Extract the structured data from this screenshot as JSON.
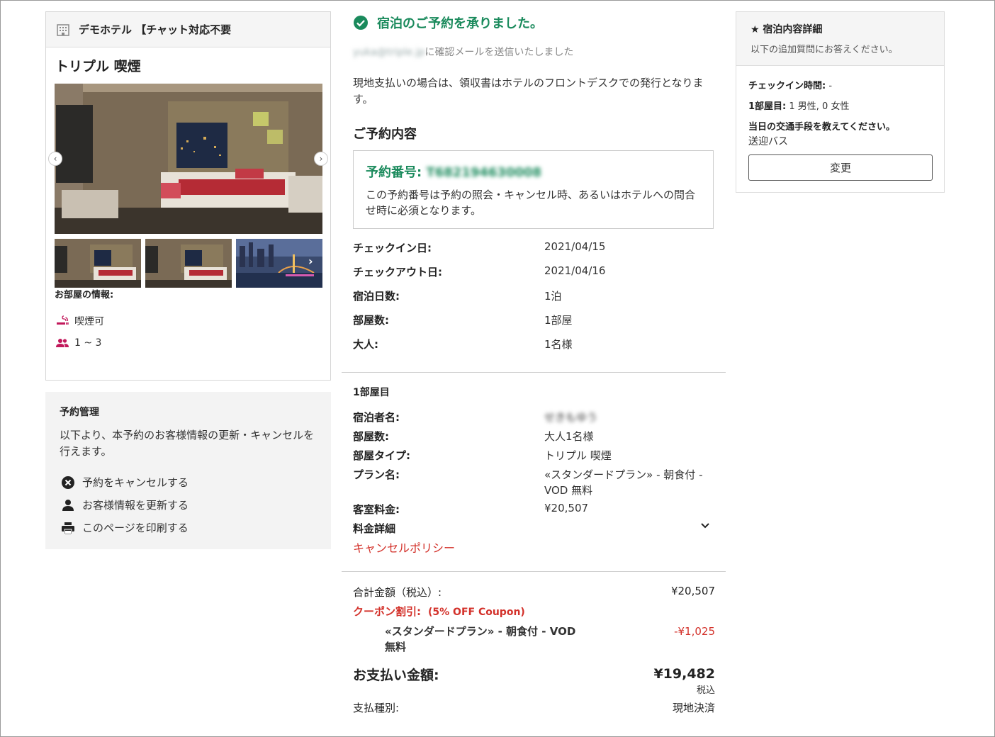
{
  "hotel": {
    "name": "デモホテル 【チャット対応不要",
    "room_title": "トリプル 喫煙",
    "room_info_label": "お部屋の情報:",
    "features": [
      {
        "icon": "smoking-icon",
        "label": "喫煙可"
      },
      {
        "icon": "people-icon",
        "label": "1 ~ 3"
      }
    ]
  },
  "manage": {
    "title": "予約管理",
    "description": "以下より、本予約のお客様情報の更新・キャンセルを行えます。",
    "links": [
      {
        "icon": "cancel-icon",
        "label": "予約をキャンセルする"
      },
      {
        "icon": "person-icon",
        "label": "お客様情報を更新する"
      },
      {
        "icon": "print-icon",
        "label": "このページを印刷する"
      }
    ]
  },
  "confirmation": {
    "success_message": "宿泊のご予約を承りました。",
    "email_blurred": "yuka@triple.jp",
    "email_suffix": "に確認メールを送信いたしました",
    "receipt_note": "現地支払いの場合は、領収書はホテルのフロントデスクでの発行となります。",
    "reservation_heading": "ご予約内容",
    "reservation_number_label": "予約番号:",
    "reservation_number_blurred": "T682194630008",
    "reservation_number_note": "この予約番号は予約の照会・キャンセル時、あるいはホテルへの問合せ時に必須となります。"
  },
  "stay": {
    "checkin_label": "チェックイン日:",
    "checkin": "2021/04/15",
    "checkout_label": "チェックアウト日:",
    "checkout": "2021/04/16",
    "nights_label": "宿泊日数:",
    "nights": "1泊",
    "rooms_label": "部屋数:",
    "rooms": "1部屋",
    "adults_label": "大人:",
    "adults": "1名様"
  },
  "room1": {
    "heading": "1部屋目",
    "guest_label": "宿泊者名:",
    "guest_blurred": "せきもゆう",
    "count_label": "部屋数:",
    "count": "大人1名様",
    "type_label": "部屋タイプ:",
    "type": "トリプル 喫煙",
    "plan_label": "プラン名:",
    "plan": "«スタンダードプラン» - 朝食付 - VOD 無料",
    "rate_label": "客室料金:",
    "rate": "¥20,507",
    "price_detail_label": "料金詳細",
    "cancel_policy": "キャンセルポリシー"
  },
  "totals": {
    "total_label": "合計金額（税込）:",
    "total": "¥20,507",
    "coupon_label": "クーポン割引:",
    "coupon_name": "(5% OFF Coupon)",
    "coupon_plan": "«スタンダードプラン» - 朝食付 - VOD 無料",
    "discount": "-¥1,025",
    "pay_label": "お支払い金額:",
    "pay_amount": "¥19,482",
    "tax_inc": "税込",
    "payment_type_label": "支払種別:",
    "payment_type": "現地決済"
  },
  "details": {
    "title": "★ 宿泊内容詳細",
    "subtitle": "以下の追加質問にお答えください。",
    "checkin_time_label": "チェックイン時間:",
    "checkin_time": " -",
    "room1_label": "1部屋目:",
    "room1_value": " 1 男性, 0 女性",
    "transport_question": "当日の交通手段を教えてください。",
    "transport_answer": "送迎バス",
    "change_button": "変更"
  },
  "colors": {
    "accent_green": "#1a8a5c",
    "accent_red": "#d3312a",
    "feature_pink": "#c2185b"
  }
}
